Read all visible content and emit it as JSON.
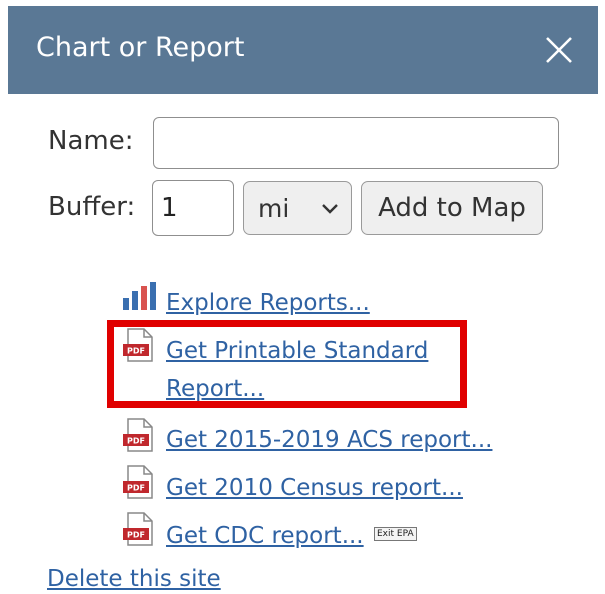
{
  "header": {
    "title": "Chart or Report",
    "close_icon": "close-icon",
    "background": "#5a7895"
  },
  "form": {
    "name_label": "Name:",
    "name_value": "",
    "buffer_label": "Buffer:",
    "buffer_value": "1",
    "unit_value": "mi",
    "add_button_label": "Add to Map"
  },
  "links": {
    "explore": "Explore Reports...",
    "printable_line1": "Get Printable Standard",
    "printable_line2": "Report...",
    "acs": "Get 2015-2019 ACS report...",
    "census": "Get 2010 Census report...",
    "cdc": "Get CDC report...",
    "exit_badge": "Exit EPA",
    "delete": "Delete this site"
  },
  "colors": {
    "link": "#2f62a3",
    "highlight": "#e00000"
  },
  "icons": {
    "explore": "bar-chart-icon",
    "report": "pdf-icon"
  }
}
